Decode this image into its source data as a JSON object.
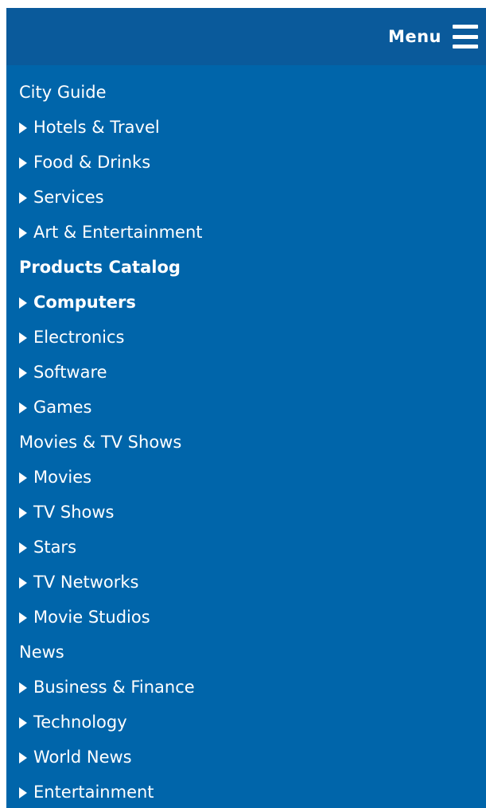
{
  "header": {
    "menu_label": "Menu"
  },
  "colors": {
    "header_bg": "#0a5a9b",
    "panel_bg": "#0065aa",
    "text": "#ffffff"
  },
  "nav": [
    {
      "label": "City Guide",
      "type": "category",
      "bold": false
    },
    {
      "label": "Hotels & Travel",
      "type": "item",
      "bold": false
    },
    {
      "label": "Food & Drinks",
      "type": "item",
      "bold": false
    },
    {
      "label": "Services",
      "type": "item",
      "bold": false
    },
    {
      "label": "Art & Entertainment",
      "type": "item",
      "bold": false
    },
    {
      "label": "Products Catalog",
      "type": "category",
      "bold": true
    },
    {
      "label": "Computers",
      "type": "item",
      "bold": true
    },
    {
      "label": "Electronics",
      "type": "item",
      "bold": false
    },
    {
      "label": "Software",
      "type": "item",
      "bold": false
    },
    {
      "label": "Games",
      "type": "item",
      "bold": false
    },
    {
      "label": "Movies & TV Shows",
      "type": "category",
      "bold": false
    },
    {
      "label": "Movies",
      "type": "item",
      "bold": false
    },
    {
      "label": "TV Shows",
      "type": "item",
      "bold": false
    },
    {
      "label": "Stars",
      "type": "item",
      "bold": false
    },
    {
      "label": "TV Networks",
      "type": "item",
      "bold": false
    },
    {
      "label": "Movie Studios",
      "type": "item",
      "bold": false
    },
    {
      "label": "News",
      "type": "category",
      "bold": false
    },
    {
      "label": "Business & Finance",
      "type": "item",
      "bold": false
    },
    {
      "label": "Technology",
      "type": "item",
      "bold": false
    },
    {
      "label": "World News",
      "type": "item",
      "bold": false
    },
    {
      "label": "Entertainment",
      "type": "item",
      "bold": false
    }
  ]
}
